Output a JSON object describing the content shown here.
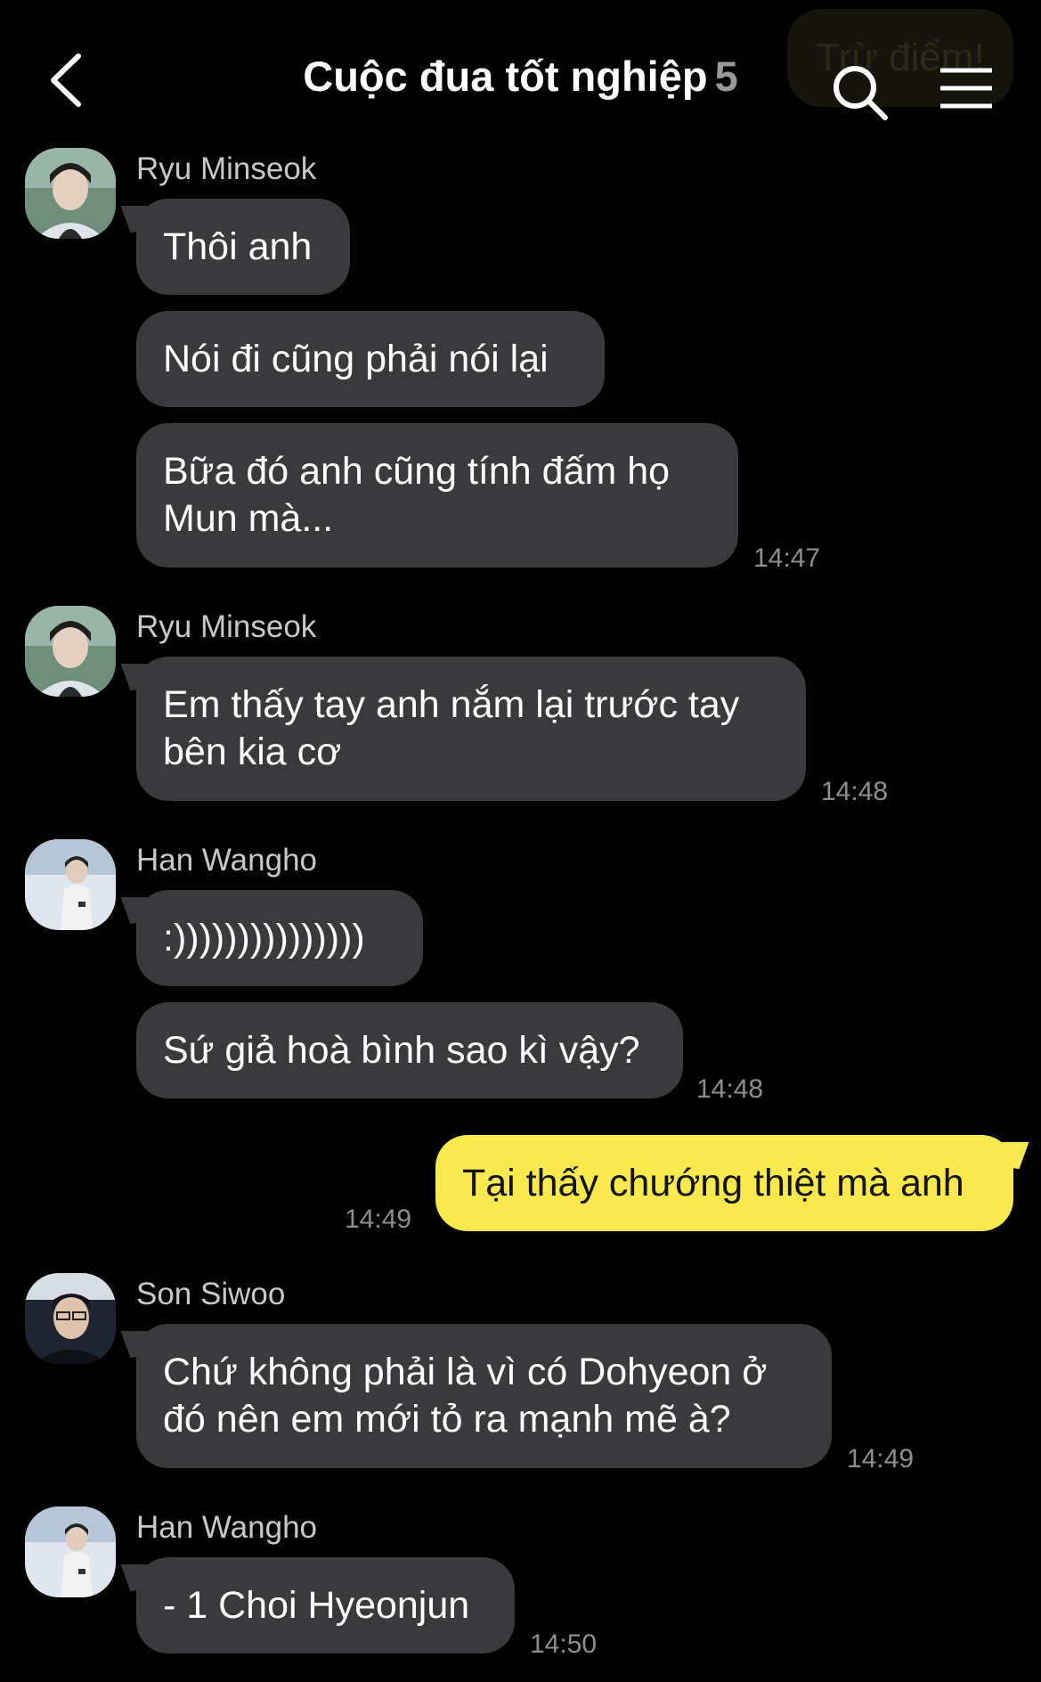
{
  "header": {
    "back_icon": "chevron-left-icon",
    "title": "Cuộc đua tốt nghiệp",
    "member_count": "5",
    "ghost_pill": "Trừ điểm!",
    "search_icon": "search-icon",
    "menu_icon": "hamburger-menu-icon"
  },
  "colors": {
    "background": "#000000",
    "incoming_bubble": "#3a3a3c",
    "outgoing_bubble": "#f9e94e",
    "timestamp": "#8e8e8e"
  },
  "messages": [
    {
      "sender": "Ryu Minseok",
      "bubbles": [
        "Thôi anh",
        "Nói đi cũng phải nói lại",
        "Bữa đó anh cũng tính đấm họ\nMun mà..."
      ],
      "time": "14:47"
    },
    {
      "sender": "Ryu Minseok",
      "bubbles": [
        "Em thấy tay anh nắm lại trước tay\nbên kia cơ"
      ],
      "time": "14:48"
    },
    {
      "sender": "Han Wangho",
      "bubbles": [
        ":)))))))))))))))",
        "Sứ giả hoà bình sao kì vậy?"
      ],
      "time": "14:48"
    },
    {
      "sender": "me",
      "bubbles": [
        "Tại thấy chướng thiệt mà anh"
      ],
      "time": "14:49"
    },
    {
      "sender": "Son Siwoo",
      "bubbles": [
        "Chứ không phải là vì có Dohyeon ở\nđó nên em mới tỏ ra mạnh mẽ à?"
      ],
      "time": "14:49"
    },
    {
      "sender": "Han Wangho",
      "bubbles": [
        "- 1 Choi Hyeonjun"
      ],
      "time": "14:50"
    }
  ]
}
